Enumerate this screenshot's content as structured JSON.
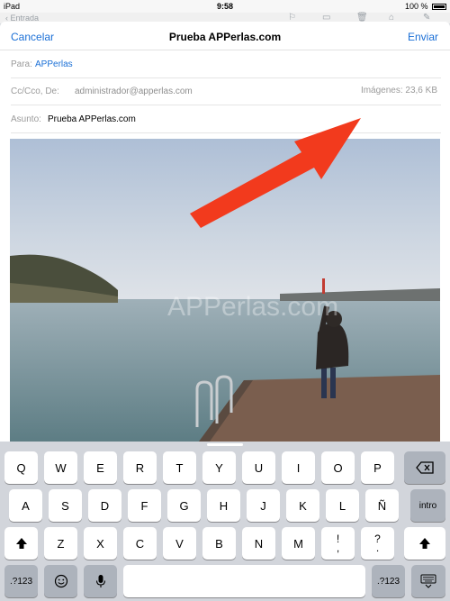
{
  "status": {
    "device": "iPad",
    "time": "9:58",
    "battery": "100 %"
  },
  "background_toolbar": {
    "back_label": "Entrada"
  },
  "compose": {
    "cancel_label": "Cancelar",
    "title": "Prueba APPerlas.com",
    "send_label": "Enviar",
    "to_label": "Para:",
    "to_value": "APPerlas",
    "cc_label": "Cc/Cco, De:",
    "cc_value": "administrador@apperlas.com",
    "images_size": "Imágenes: 23,6 KB",
    "subject_label": "Asunto:",
    "subject_value": "Prueba APPerlas.com"
  },
  "photo": {
    "watermark": "APPerlas.com"
  },
  "annotation": {
    "arrow_color": "#f23a1d"
  },
  "keyboard": {
    "row1": [
      "Q",
      "W",
      "E",
      "R",
      "T",
      "Y",
      "U",
      "I",
      "O",
      "P"
    ],
    "row2": [
      "A",
      "S",
      "D",
      "F",
      "G",
      "H",
      "J",
      "K",
      "L",
      "Ñ"
    ],
    "row3": [
      "Z",
      "X",
      "C",
      "V",
      "B",
      "N",
      "M"
    ],
    "return_label": "intro",
    "punct1_top": "!",
    "punct1_bottom": ",",
    "punct2_top": "?",
    "punct2_bottom": ".",
    "numbers_label": ".?123",
    "backspace_icon": "backspace-icon",
    "shift_icon": "shift-icon",
    "emoji_icon": "emoji-icon",
    "mic_icon": "microphone-icon",
    "hide_icon": "keyboard-hide-icon"
  },
  "colors": {
    "accent": "#1a6fd6",
    "keyboard_bg": "#d2d5db",
    "key_dark": "#adb3bc"
  }
}
